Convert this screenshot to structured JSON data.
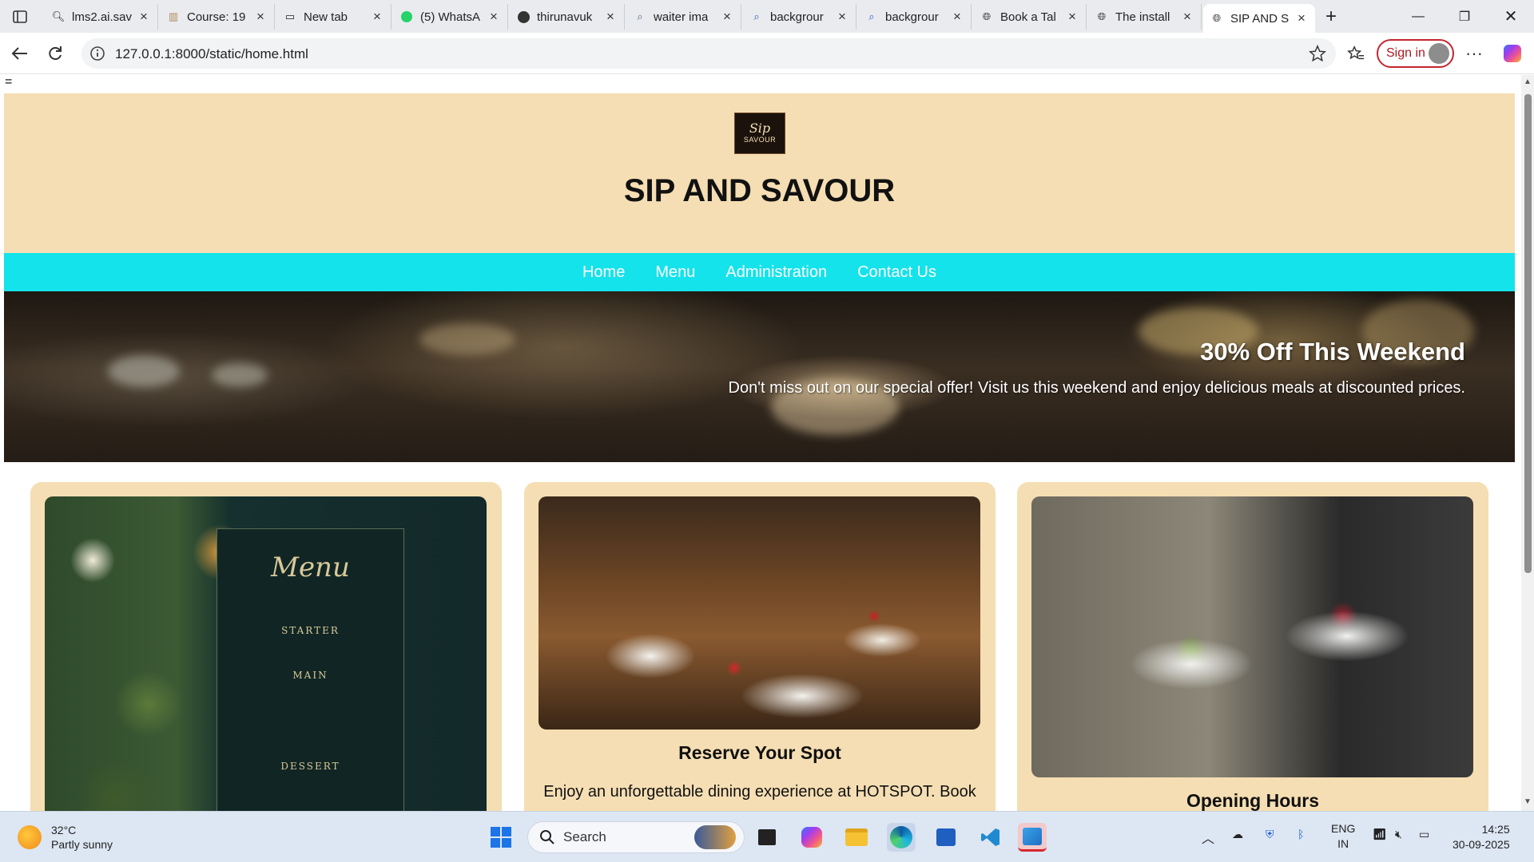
{
  "browser": {
    "tabs": [
      {
        "label": "lms2.ai.sav",
        "icon": "search-icon"
      },
      {
        "label": "Course: 19",
        "icon": "course-icon"
      },
      {
        "label": "New tab",
        "icon": "newtab-icon"
      },
      {
        "label": "(5) WhatsA",
        "icon": "whatsapp-icon"
      },
      {
        "label": "thirunavuk",
        "icon": "github-icon"
      },
      {
        "label": "waiter ima",
        "icon": "search-icon"
      },
      {
        "label": "backgrour",
        "icon": "search-icon"
      },
      {
        "label": "backgrour",
        "icon": "search-icon"
      },
      {
        "label": "Book a Tal",
        "icon": "globe-icon"
      },
      {
        "label": "The install",
        "icon": "globe-icon"
      },
      {
        "label": "SIP AND S",
        "icon": "globe-icon",
        "active": true
      }
    ],
    "url": "127.0.0.1:8000/static/home.html",
    "sign_in": "Sign in"
  },
  "page": {
    "stray_text": "=",
    "logo": {
      "line1": "Sip",
      "line2": "SAVOUR"
    },
    "title": "SIP AND SAVOUR",
    "nav": [
      "Home",
      "Menu",
      "Administration",
      "Contact Us"
    ],
    "hero": {
      "title": "30% Off This Weekend",
      "text": "Don't miss out on our special offer! Visit us this weekend and enjoy delicious meals at discounted prices."
    },
    "menu_card_image": {
      "title": "Menu",
      "s1": "STARTER",
      "s2": "MAIN",
      "s3": "DESSERT"
    },
    "cards": [
      {
        "heading": "",
        "text": ""
      },
      {
        "heading": "Reserve Your Spot",
        "text": "Enjoy an unforgettable dining experience at HOTSPOT. Book"
      },
      {
        "heading": "Opening Hours",
        "text": ""
      }
    ]
  },
  "taskbar": {
    "weather_temp": "32°C",
    "weather_desc": "Partly sunny",
    "search_placeholder": "Search",
    "lang1": "ENG",
    "lang2": "IN",
    "time": "14:25",
    "date": "30-09-2025"
  }
}
